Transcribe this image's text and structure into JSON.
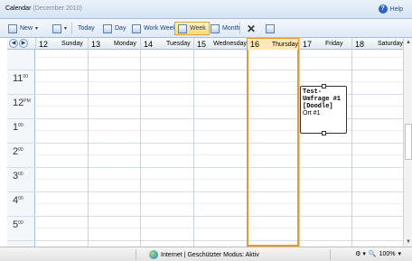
{
  "window": {
    "title": "Calendar",
    "subtitle": "(December 2010)",
    "help_label": "Help"
  },
  "toolbar": {
    "new_label": "New",
    "today_label": "Today",
    "day_label": "Day",
    "workweek_label": "Work Week",
    "week_label": "Week",
    "month_label": "Month",
    "active_view": "Week"
  },
  "days": [
    {
      "num": "12",
      "name": "Sunday"
    },
    {
      "num": "13",
      "name": "Monday"
    },
    {
      "num": "14",
      "name": "Tuesday"
    },
    {
      "num": "15",
      "name": "Wednesday"
    },
    {
      "num": "16",
      "name": "Thursday",
      "today": true
    },
    {
      "num": "17",
      "name": "Friday"
    },
    {
      "num": "18",
      "name": "Saturday"
    }
  ],
  "hours": [
    {
      "h": "11",
      "s": "00"
    },
    {
      "h": "12",
      "s": "PM"
    },
    {
      "h": "1",
      "s": "00"
    },
    {
      "h": "2",
      "s": "00"
    },
    {
      "h": "3",
      "s": "00"
    },
    {
      "h": "4",
      "s": "00"
    },
    {
      "h": "5",
      "s": "00"
    }
  ],
  "event": {
    "title": "Test-Umfrage #1 [Doodle]",
    "location": "Ort #1",
    "day": "17"
  },
  "status": {
    "zone": "Internet | Geschützter Modus: Aktiv",
    "zoom": "100%"
  },
  "colors": {
    "today_border": "#e39b2c",
    "header_bg": "#d6e4f5"
  }
}
